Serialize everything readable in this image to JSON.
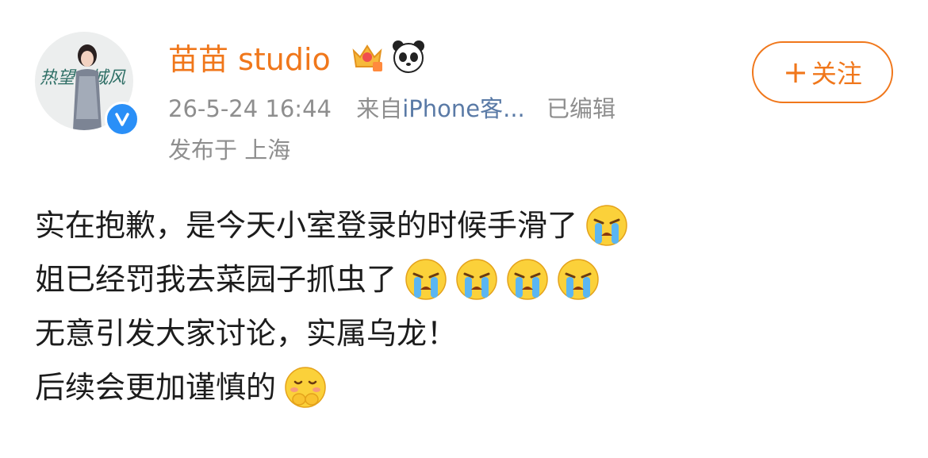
{
  "user": {
    "name": "苗苗 studio",
    "avatar_text_left": "热望",
    "avatar_text_right": "城风"
  },
  "meta": {
    "time": "26-5-24 16:44",
    "from_prefix": "来自",
    "source": "iPhone客...",
    "edited": "已编辑",
    "location": "发布于 上海"
  },
  "follow": {
    "label": "关注"
  },
  "post": {
    "lines": [
      "实在抱歉，是今天小室登录的时候手滑了",
      "姐已经罚我去菜园子抓虫了",
      "无意引发大家讨论，实属乌龙！",
      "后续会更加谨慎的"
    ]
  },
  "icons": {
    "verify": "verified-badge-icon",
    "crown": "vip-crown-icon",
    "panda": "panda-icon",
    "cry": "crying-face-emoji",
    "shy": "shy-face-emoji"
  },
  "colors": {
    "accent": "#f0771b",
    "verify": "#2a8ff7",
    "meta": "#8e8e8e"
  }
}
